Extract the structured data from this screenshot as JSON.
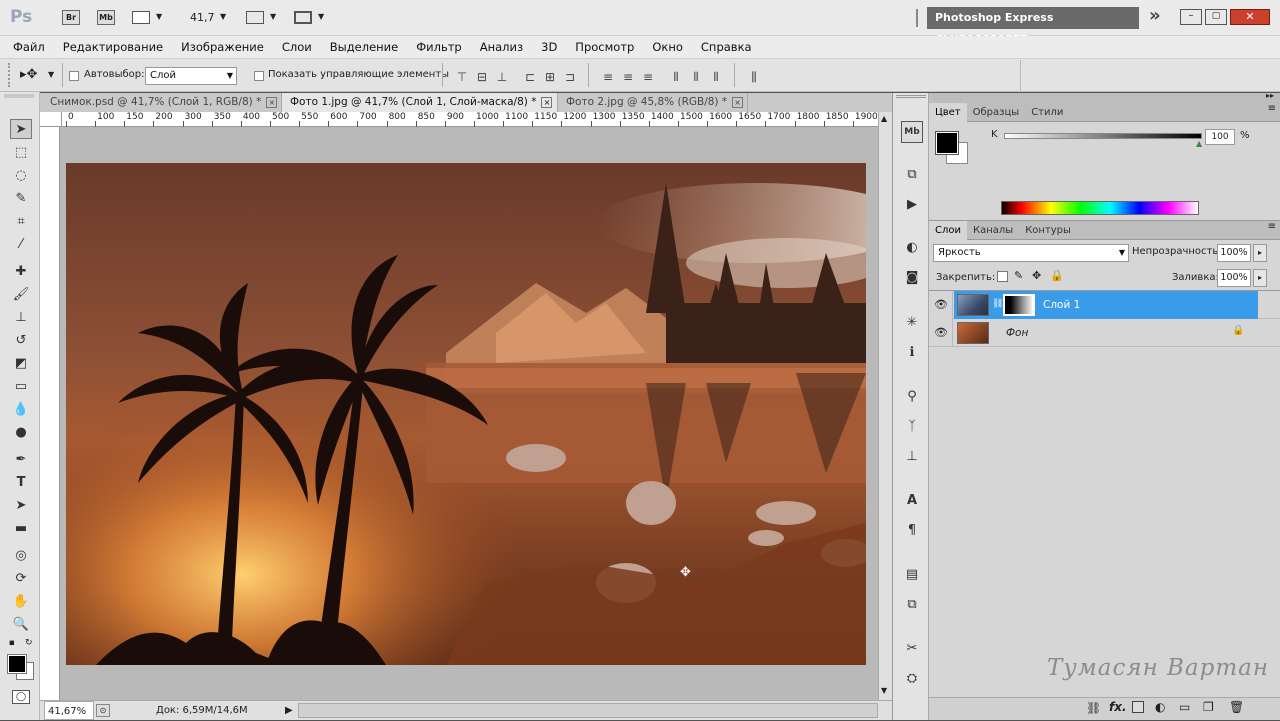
{
  "titlebar": {
    "ps_logo": "Ps",
    "br_label": "Br",
    "mb_label": "Mb",
    "zoom": "41,7",
    "express_label": "Photoshop Express CLUB18839577",
    "more": "»"
  },
  "menu": [
    "Файл",
    "Редактирование",
    "Изображение",
    "Слои",
    "Выделение",
    "Фильтр",
    "Анализ",
    "3D",
    "Просмотр",
    "Окно",
    "Справка"
  ],
  "options": {
    "autoselect_label": "Автовыбор:",
    "autoselect_value": "Слой",
    "show_controls_label": "Показать управляющие элементы"
  },
  "doc_tabs": [
    {
      "label": "Снимок.psd @ 41,7% (Слой 1, RGB/8) *",
      "close": "×"
    },
    {
      "label": "Фото 1.jpg @ 41,7% (Слой 1, Слой-маска/8) *",
      "close": "×"
    },
    {
      "label": "Фото 2.jpg @ 45,8% (RGB/8) *",
      "close": "×"
    }
  ],
  "ruler_top": [
    "0",
    "100",
    "150",
    "200",
    "300",
    "350",
    "400",
    "500",
    "550",
    "600",
    "700",
    "800",
    "850",
    "900",
    "1000",
    "1100",
    "1150",
    "1200",
    "1300",
    "1350",
    "1400",
    "1500",
    "1600",
    "1650",
    "1700",
    "1800",
    "1850",
    "1900"
  ],
  "status": {
    "zoom": "41,67%",
    "doc_info": "Док: 6,59M/14,6M",
    "arrow": "▶"
  },
  "color_panel": {
    "tabs": [
      "Цвет",
      "Образцы",
      "Стили"
    ],
    "channel_label": "K",
    "value": "100",
    "unit": "%",
    "fg_color": "#000000",
    "bg_color": "#ffffff"
  },
  "layers_panel": {
    "tabs": [
      "Слои",
      "Каналы",
      "Контуры"
    ],
    "blend_mode": "Яркость",
    "opacity_label": "Непрозрачность:",
    "opacity_value": "100%",
    "lock_label": "Закрепить:",
    "fill_label": "Заливка:",
    "fill_value": "100%",
    "layers": [
      {
        "name": "Слой 1",
        "selected": true
      },
      {
        "name": "Фон",
        "selected": false
      }
    ],
    "bottom_icons": [
      "link-icon",
      "fx-icon",
      "mask-icon",
      "adjustment-icon",
      "folder-icon",
      "new-layer-icon",
      "trash-icon"
    ],
    "fx_label": "fx."
  },
  "watermark": "Тумасян Вартан",
  "accent": "#3a9ce9"
}
